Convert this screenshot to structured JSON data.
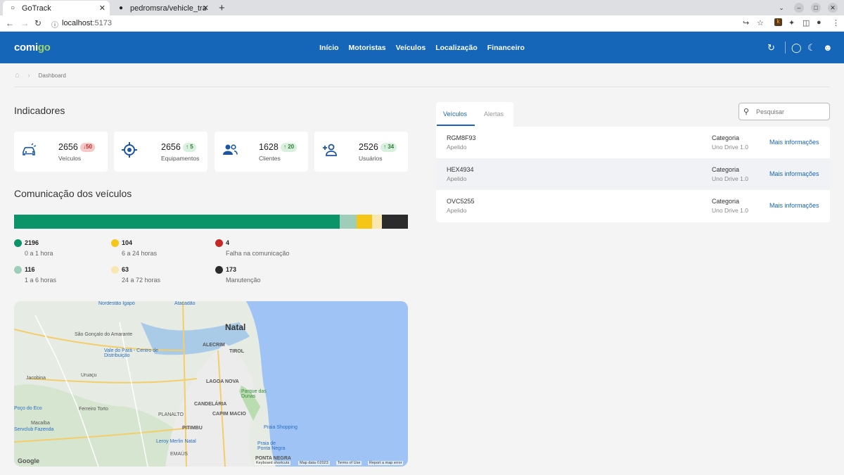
{
  "browser": {
    "tabs": [
      {
        "title": "GoTrack",
        "active": true
      },
      {
        "title": "pedromsra/vehicle_track",
        "active": false
      }
    ],
    "url_host": "localhost",
    "url_port": ":5173"
  },
  "header": {
    "logo_main": "comi",
    "logo_accent": "go",
    "menu": [
      "Início",
      "Motoristas",
      "Veículos",
      "Localização",
      "Financeiro"
    ]
  },
  "breadcrumb": {
    "current": "Dashboard"
  },
  "indicators": {
    "title": "Indicadores",
    "cards": [
      {
        "value": "2656",
        "delta": "50",
        "trend": "down",
        "label": "Veículos",
        "icon": "car-icon"
      },
      {
        "value": "2656",
        "delta": "5",
        "trend": "up",
        "label": "Equipamentos",
        "icon": "crosshair-icon"
      },
      {
        "value": "1628",
        "delta": "20",
        "trend": "up",
        "label": "Clientes",
        "icon": "users-icon"
      },
      {
        "value": "2526",
        "delta": "34",
        "trend": "up",
        "label": "Usuários",
        "icon": "user-add-icon"
      }
    ]
  },
  "communication": {
    "title": "Comunicação dos veículos",
    "bar": [
      {
        "value": 2196,
        "color": "#0a9467"
      },
      {
        "value": 116,
        "color": "#9ecdb9"
      },
      {
        "value": 104,
        "color": "#f5c518"
      },
      {
        "value": 63,
        "color": "#f8e7b0"
      },
      {
        "value": 4,
        "color": "#c62828"
      },
      {
        "value": 173,
        "color": "#2b2b2b"
      }
    ],
    "legend": [
      {
        "value": "2196",
        "label": "0 a 1 hora",
        "color": "#0a9467"
      },
      {
        "value": "104",
        "label": "6 a 24 horas",
        "color": "#f5c518"
      },
      {
        "value": "4",
        "label": "Falha na comunicação",
        "color": "#c62828"
      },
      {
        "value": "116",
        "label": "1 a 6 horas",
        "color": "#9ecdb9"
      },
      {
        "value": "63",
        "label": "24 a 72 horas",
        "color": "#f8e7b0"
      },
      {
        "value": "173",
        "label": "Manutenção",
        "color": "#2b2b2b"
      }
    ]
  },
  "map": {
    "city": "Natal",
    "labels": [
      "São Gonçalo do Amarante",
      "Jacobina",
      "Uruaçu",
      "Ferreiro Torto",
      "Macaíba",
      "ALECRIM",
      "TIROL",
      "LAGOA NOVA",
      "CANDELÁRIA",
      "CAPIM MACIO",
      "PLANALTO",
      "PITIMBU",
      "EMAÚS",
      "PONTA NEGRA",
      "Parque das Dunas",
      "Nordestão Igapó",
      "Atacadão",
      "Vale do Pará - Centro de Distribuição",
      "Poço do Eco",
      "Servclub Fazenda",
      "Praia Shopping",
      "Leroy Merlin Natal",
      "Praia de Ponta Negra"
    ],
    "footer": [
      "Keyboard shortcuts",
      "Map data ©2023",
      "Terms of Use",
      "Report a map error"
    ],
    "brand": "Google"
  },
  "panel": {
    "tabs": [
      "Veículos",
      "Alertas"
    ],
    "search_placeholder": "Pesquisar",
    "rows": [
      {
        "plate": "RGM8F93",
        "nick": "Apelido",
        "cat_label": "Categoria",
        "model": "Uno Drive 1.0",
        "more": "Mais informações"
      },
      {
        "plate": "HEX4934",
        "nick": "Apelido",
        "cat_label": "Categoria",
        "model": "Uno Drive 1.0",
        "more": "Mais informações"
      },
      {
        "plate": "OVC5255",
        "nick": "Apelido",
        "cat_label": "Categoria",
        "model": "Uno Drive 1.0",
        "more": "Mais informações"
      }
    ]
  }
}
